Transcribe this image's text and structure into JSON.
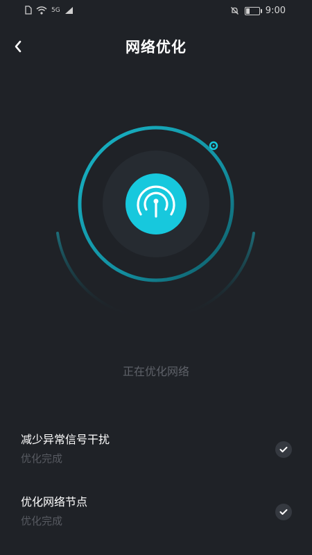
{
  "status_bar": {
    "network": "5G",
    "time": "9:00"
  },
  "header": {
    "title": "网络优化"
  },
  "main": {
    "status_text": "正在优化网络"
  },
  "tasks": [
    {
      "title": "减少异常信号干扰",
      "status": "优化完成"
    },
    {
      "title": "优化网络节点",
      "status": "优化完成"
    }
  ],
  "colors": {
    "background": "#1f2227",
    "accent": "#17c8dd",
    "inner_circle": "#262b31",
    "check_bg": "#353940"
  },
  "icons": {
    "back": "chevron-left-icon",
    "center": "broadcast-signal-icon",
    "check": "check-icon"
  }
}
